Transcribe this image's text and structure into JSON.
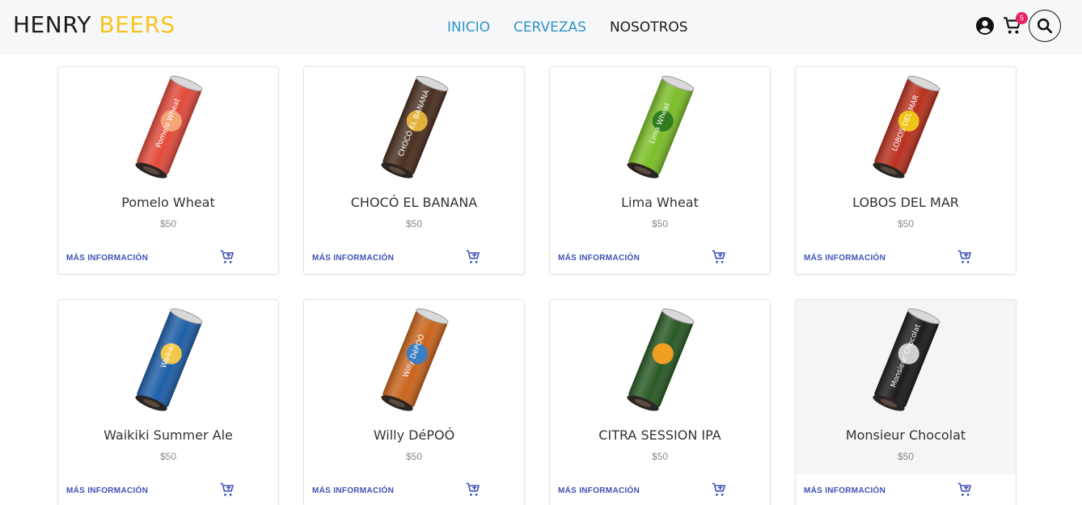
{
  "header": {
    "brand_part1": "HENRY",
    "brand_part2": "BEERS",
    "nav": [
      {
        "label": "INICIO"
      },
      {
        "label": "CERVEZAS"
      },
      {
        "label": "NOSOTROS"
      }
    ],
    "cart_count": "5",
    "colors": {
      "brand_accent": "#f6c421",
      "nav_active": "#2e95c4",
      "badge": "#e91e63",
      "link": "#3f51b5"
    },
    "icons": [
      "user-circle-icon",
      "cart-icon",
      "search-icon"
    ]
  },
  "products": [
    {
      "name": "Pomelo Wheat",
      "price": "$50",
      "more_label": "MÁS INFORMACIÓN",
      "can_color": "#e24b3b",
      "can_accent": "#f5a37a",
      "can_text": "Pomelo Wheat"
    },
    {
      "name": "CHOCÓ EL BANANA",
      "price": "$50",
      "more_label": "MÁS INFORMACIÓN",
      "can_color": "#4a3020",
      "can_accent": "#e3b23c",
      "can_text": "CHOCÓ EL BANANA"
    },
    {
      "name": "Lima Wheat",
      "price": "$50",
      "more_label": "MÁS INFORMACIÓN",
      "can_color": "#7cbf2a",
      "can_accent": "#2f7d1c",
      "can_text": "Lima Wheat"
    },
    {
      "name": "LOBOS DEL MAR",
      "price": "$50",
      "more_label": "MÁS INFORMACIÓN",
      "can_color": "#b8321f",
      "can_accent": "#f0c419",
      "can_text": "LOBOS DEL MAR"
    },
    {
      "name": "Waikiki Summer Ale",
      "price": "$50",
      "more_label": "MÁS INFORMACIÓN",
      "can_color": "#1f5fa8",
      "can_accent": "#f3c84a",
      "can_text": "Waikiki"
    },
    {
      "name": "Willy DéPOÓ",
      "price": "$50",
      "more_label": "MÁS INFORMACIÓN",
      "can_color": "#c9651e",
      "can_accent": "#3a7fc2",
      "can_text": "Willy DéPOÓ"
    },
    {
      "name": "CITRA SESSION IPA",
      "price": "$50",
      "more_label": "MÁS INFORMACIÓN",
      "can_color": "#2a5a26",
      "can_accent": "#f0a021",
      "can_text": ""
    },
    {
      "name": "Monsieur Chocolat",
      "price": "$50",
      "more_label": "MÁS INFORMACIÓN",
      "can_color": "#1c1c1c",
      "can_accent": "#cfcfcf",
      "can_text": "Monsieur Chocolat"
    }
  ]
}
